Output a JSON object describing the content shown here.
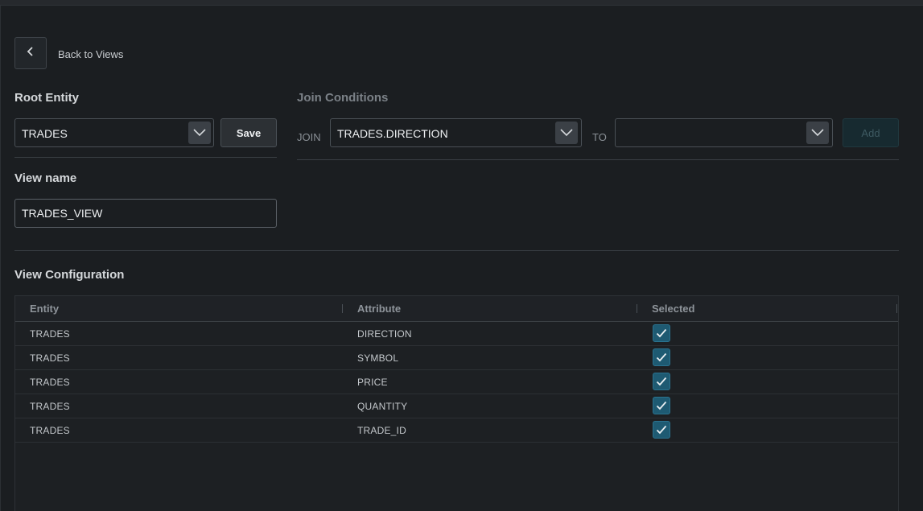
{
  "nav": {
    "back_label": "Back to Views"
  },
  "root_entity": {
    "title": "Root Entity",
    "selected": "TRADES",
    "save_label": "Save"
  },
  "join": {
    "title": "Join Conditions",
    "join_label": "JOIN",
    "join_selected": "TRADES.DIRECTION",
    "to_label": "TO",
    "to_selected": "",
    "add_label": "Add"
  },
  "view_name": {
    "title": "View name",
    "value": "TRADES_VIEW"
  },
  "config": {
    "title": "View Configuration",
    "columns": [
      "Entity",
      "Attribute",
      "Selected"
    ],
    "rows": [
      {
        "entity": "TRADES",
        "attribute": "DIRECTION",
        "selected": true
      },
      {
        "entity": "TRADES",
        "attribute": "SYMBOL",
        "selected": true
      },
      {
        "entity": "TRADES",
        "attribute": "PRICE",
        "selected": true
      },
      {
        "entity": "TRADES",
        "attribute": "QUANTITY",
        "selected": true
      },
      {
        "entity": "TRADES",
        "attribute": "TRADE_ID",
        "selected": true
      }
    ]
  },
  "colors": {
    "background": "#1b1e21",
    "checkbox": "#1e5a72",
    "add_button_disabled": "#172a30"
  },
  "icons": {
    "back": "chevron-left-icon",
    "dropdown": "chevron-down-icon",
    "check": "check-icon"
  }
}
